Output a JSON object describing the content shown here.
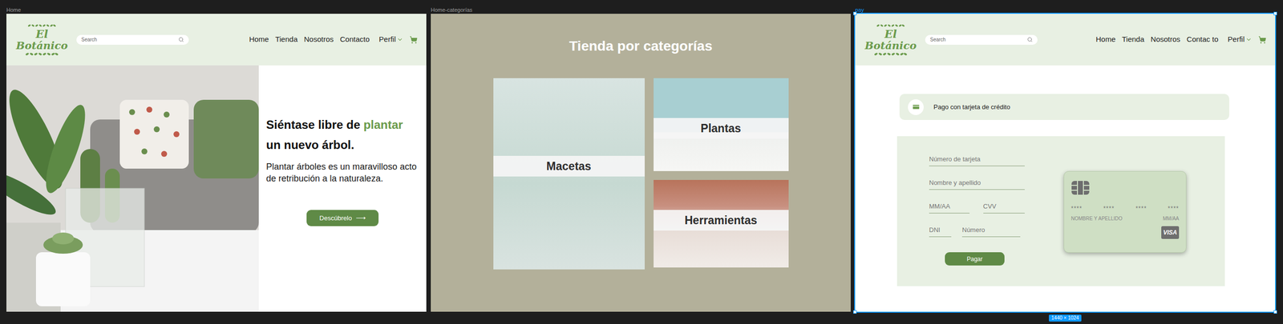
{
  "canvas": {
    "selection_size": "1440 × 1024"
  },
  "frames": [
    {
      "kind": "home",
      "label": "Home",
      "selected": false,
      "header": {
        "logo": {
          "top": "El",
          "bottom": "Botánico"
        },
        "search": {
          "placeholder": "Search"
        },
        "nav": [
          {
            "label": "Home"
          },
          {
            "label": "Tienda"
          },
          {
            "label": "Nosotros"
          },
          {
            "label": "Contacto"
          }
        ],
        "profile": "Perfil"
      },
      "hero": {
        "heading": {
          "before": "Siéntase libre de ",
          "highlight": "plantar",
          "after": " un nuevo árbol."
        },
        "text": "Plantar árboles es un maravilloso acto de retribución a la naturaleza.",
        "button": {
          "label": "Descúbrelo",
          "arrow": "⟶"
        }
      }
    },
    {
      "kind": "categories",
      "label": "Home-categorías",
      "selected": false,
      "title": "Tienda por categorías",
      "categories": [
        {
          "label": "Macetas"
        },
        {
          "label": "Plantas"
        },
        {
          "label": "Herramientas"
        }
      ]
    },
    {
      "kind": "pay",
      "label": "pay",
      "selected": true,
      "header": {
        "logo": {
          "top": "El",
          "bottom": "Botánico"
        },
        "search": {
          "placeholder": "Search"
        },
        "nav": [
          {
            "label": "Home"
          },
          {
            "label": "Tienda"
          },
          {
            "label": "Nosotros"
          },
          {
            "label": "Contac to"
          }
        ],
        "profile": "Perfil"
      },
      "payment": {
        "method": "Pago con tarjeta de crédito",
        "rows": [
          [
            {
              "placeholder": "Número de tarjeta"
            }
          ],
          [
            {
              "placeholder": "Nombre y apellido"
            }
          ],
          [
            {
              "placeholder": "MM/AA"
            },
            {
              "placeholder": "CVV"
            }
          ],
          [
            {
              "placeholder": "DNI"
            },
            {
              "placeholder": "Número"
            }
          ]
        ],
        "button": "Pagar",
        "card": {
          "groups": [
            "****",
            "****",
            "****",
            "****"
          ],
          "name": "NOMBRE Y APELLIDO",
          "expiry": "MM/AA",
          "brand": "VISA"
        }
      }
    }
  ]
}
